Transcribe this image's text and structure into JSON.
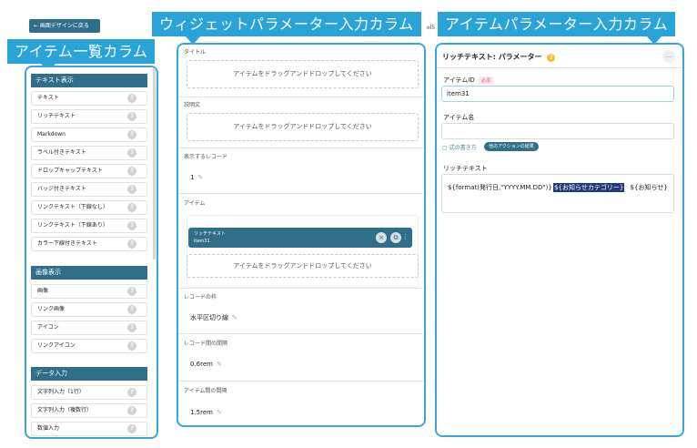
{
  "annotations": {
    "left": "アイテム一覧カラム",
    "middle": "ウィジェットパラメーター入力カラム",
    "right": "アイテムパラメーター入力カラム"
  },
  "back_button": "← 画面デザインに戻る",
  "hidden_text": "el5",
  "palette": {
    "sections": [
      {
        "title": "テキスト表示",
        "items": [
          "テキスト",
          "リッチテキスト",
          "Markdown",
          "ラベル付きテキスト",
          "ドロップキャップテキスト",
          "バッジ付きテキスト",
          "リンクテキスト（下線なし）",
          "リンクテキスト（下線あり）",
          "カラー下線付きテキスト"
        ]
      },
      {
        "title": "画像表示",
        "items": [
          "画像",
          "リンク画像",
          "アイコン",
          "リンクアイコン"
        ]
      },
      {
        "title": "データ入力",
        "items": [
          "文字列入力（1行）",
          "文字列入力（複数行）",
          "数値入力"
        ]
      }
    ],
    "help_glyph": "?"
  },
  "widget": {
    "title_label": "タイトル",
    "description_label": "説明文",
    "dropzone_text": "アイテムをドラッグアンドドロップしてください",
    "records_label": "表示するレコード",
    "records_value": "1",
    "items_label": "アイテム",
    "chip_title": "リッチテキスト",
    "chip_sub": "item31",
    "record_frame_label": "レコードの枠",
    "record_frame_value": "水平区切り線",
    "record_gap_label": "レコード間の間隔",
    "record_gap_value": "0.6rem",
    "item_gap_label": "アイテム間の間隔",
    "item_gap_value": "1.5rem"
  },
  "item_params": {
    "header": "リッチテキスト: パラメーター",
    "id_label": "アイテムID",
    "required": "必須",
    "id_value": "item31",
    "name_label": "アイテム名",
    "name_value": "",
    "formula_link": "式の書き方",
    "action_button": "他のアクションの結果",
    "richtext_label": "リッチテキスト",
    "richtext_pre": "${format(発行日,\"YYYY.MM.DD\")}",
    "richtext_highlight": "${お知らせカテゴリー}",
    "richtext_post": "${お知らせ}"
  },
  "colors": {
    "accent": "#2aa3d9",
    "panel_border": "#3aa6dc",
    "dark": "#2f6f89",
    "help_icon": "#f2c12e"
  }
}
